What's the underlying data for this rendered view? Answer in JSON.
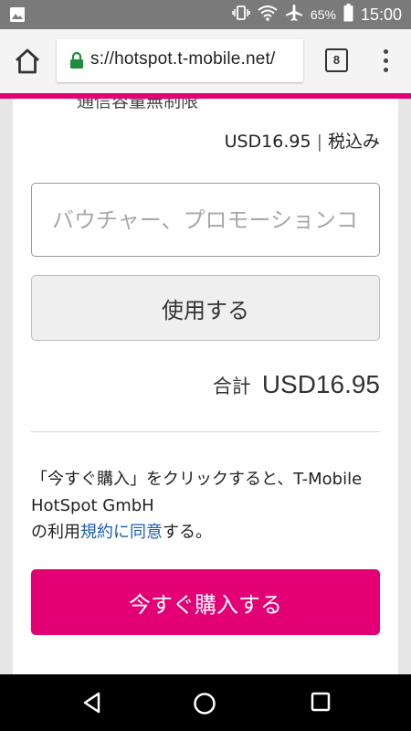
{
  "status_bar": {
    "battery_percent": "65%",
    "time": "15:00"
  },
  "browser": {
    "url": "s://hotspot.t-mobile.net/",
    "tab_count": "8"
  },
  "page": {
    "cut_off_heading": "通信容量無制限",
    "price": "USD16.95",
    "price_separator": "|",
    "tax_included": "税込み",
    "voucher_placeholder": "バウチャー、プロモーションコード",
    "use_button_label": "使用する",
    "total_label": "合計",
    "total_value": "USD16.95",
    "terms_prefix": "「今すぐ購入」をクリックすると、T-Mobile HotSpot GmbH",
    "terms_no": "の利用",
    "terms_link": "規約に同意",
    "terms_suffix": "する。",
    "buy_button_label": "今すぐ購入する"
  },
  "colors": {
    "accent": "#e20074",
    "link": "#1a5fb4",
    "lock": "#1e8e3e"
  },
  "icons": [
    "image-icon",
    "vibrate-icon",
    "wifi-icon",
    "airplane-icon",
    "battery-icon",
    "home-icon",
    "lock-icon",
    "tabs-icon",
    "menu-icon",
    "back-icon",
    "nav-home-icon",
    "recents-icon"
  ]
}
